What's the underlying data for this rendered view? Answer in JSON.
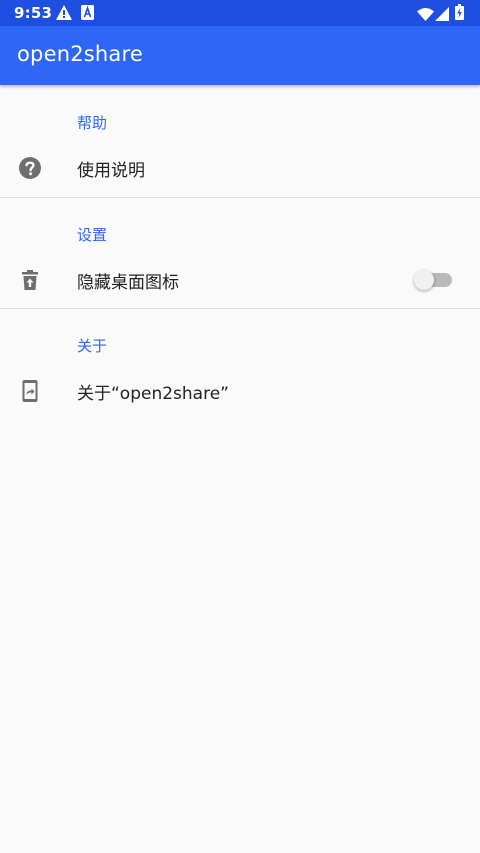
{
  "status_bar": {
    "time": "9:53",
    "icons": [
      "warning-icon",
      "a-notification-icon",
      "wifi-icon",
      "cellular-signal-icon",
      "battery-charging-icon"
    ],
    "color": "#1f4fe0"
  },
  "app_bar": {
    "title": "open2share",
    "color": "#2e66f5"
  },
  "sections": {
    "help": {
      "header": "帮助",
      "item_label": "使用说明",
      "icon": "help-circle-icon"
    },
    "settings": {
      "header": "设置",
      "item_label": "隐藏桌面图标",
      "icon": "delete-restore-icon",
      "toggle_on": false
    },
    "about": {
      "header": "关于",
      "item_label": "关于“open2share”",
      "icon": "phone-share-icon"
    }
  },
  "colors": {
    "accent": "#2e66f5",
    "background": "#fafafa",
    "text": "#212121",
    "icon": "#6e6e6e"
  }
}
